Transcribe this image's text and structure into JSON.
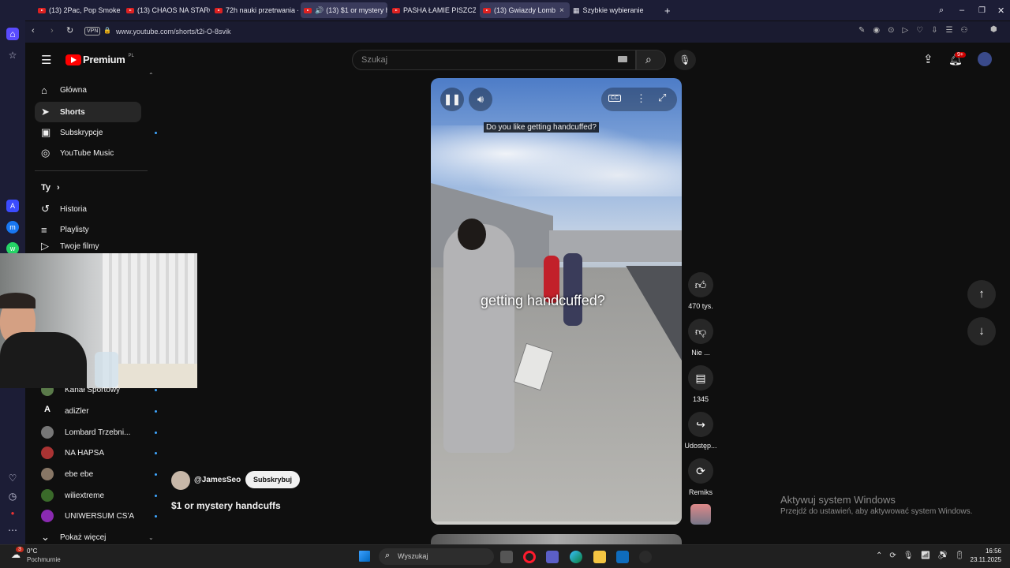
{
  "browser": {
    "tabs": [
      {
        "label": "(13) 2Pac, Pop Smoke - W"
      },
      {
        "label": "(13) CHAOS NA STARCIE,"
      },
      {
        "label": "72h nauki przetrwania - c"
      },
      {
        "label": "(13) $1 or mystery har"
      },
      {
        "label": "PASHA ŁAMIE PISZCZEL! 🩼"
      },
      {
        "label": "(13) Gwiazdy Lombar"
      },
      {
        "label": "Szybkie wybieranie"
      }
    ],
    "vpn": "VPN",
    "url": "www.youtube.com/shorts/t2i-O-8svik"
  },
  "youtube": {
    "logo": "Premium",
    "logo_region": "PL",
    "search_placeholder": "Szukaj",
    "notifications": "9+",
    "nav": [
      {
        "label": "Główna",
        "icon": "home-icon"
      },
      {
        "label": "Shorts",
        "icon": "shorts-icon"
      },
      {
        "label": "Subskrypcje",
        "icon": "subscriptions-icon"
      },
      {
        "label": "YouTube Music",
        "icon": "music-icon"
      }
    ],
    "you_section": "Ty",
    "you_items": [
      {
        "label": "Historia"
      },
      {
        "label": "Playlisty"
      },
      {
        "label": "Twoje filmy"
      }
    ],
    "subs": [
      {
        "label": "Kanał Sportowy"
      },
      {
        "label": "adiZler"
      },
      {
        "label": "Lombard Trzebni..."
      },
      {
        "label": "NA HAPSA"
      },
      {
        "label": "ebe ebe"
      },
      {
        "label": "wiliextreme"
      },
      {
        "label": "UNIWERSUM CS'A"
      }
    ],
    "show_more": "Pokaż więcej",
    "short": {
      "channel": "@JamesSeo",
      "subscribe": "Subskrybuj",
      "title": "$1 or mystery handcuffs",
      "caption_top": "Do you like getting handcuffed?",
      "caption_mid": "getting handcuffed?"
    },
    "actions": {
      "likes": "470 tys.",
      "dislike": "Nie ...",
      "comments": "1345",
      "share": "Udostęp...",
      "remix": "Remiks"
    }
  },
  "windows": {
    "activate_title": "Aktywuj system Windows",
    "activate_sub": "Przejdź do ustawień, aby aktywować system Windows.",
    "weather_temp": "0°C",
    "weather_desc": "Pochmurnie",
    "weather_badge": "3",
    "search": "Wyszukaj",
    "time": "16:56",
    "date": "23.11.2025"
  }
}
